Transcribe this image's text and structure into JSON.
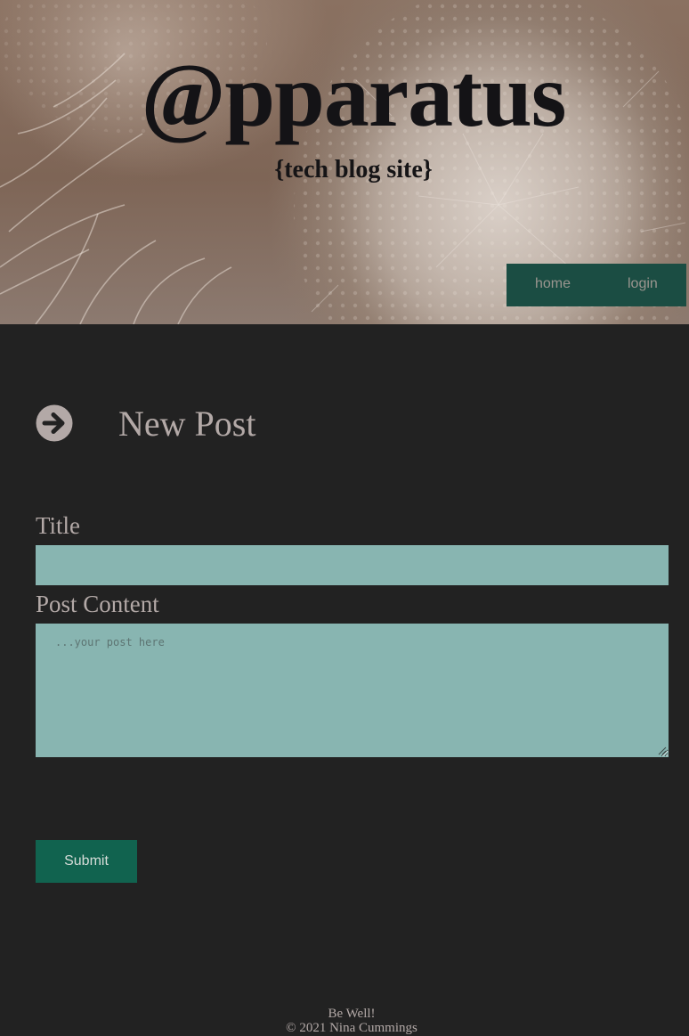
{
  "header": {
    "site_title": "@pparatus",
    "subtitle": "{tech blog site}",
    "nav": {
      "home_label": "home",
      "login_label": "login"
    }
  },
  "main": {
    "page_title": "New Post",
    "heading_icon": "arrow-circle-right-icon",
    "form": {
      "title_label": "Title",
      "title_value": "",
      "content_label": "Post Content",
      "content_placeholder": "...your post here",
      "submit_label": "Submit"
    }
  },
  "footer": {
    "tagline": "Be Well!",
    "copyright": "© 2021 Nina Cummings"
  },
  "colors": {
    "page_background": "#222222",
    "nav_background": "#1b4d43",
    "input_background": "#88b5b1",
    "submit_background": "#11634f",
    "text": "#b3a9a7"
  }
}
